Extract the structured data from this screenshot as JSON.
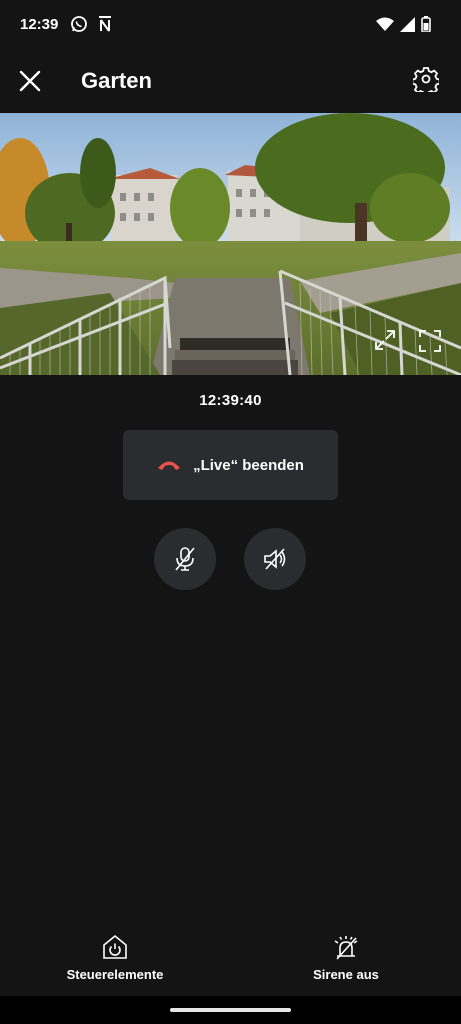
{
  "status_bar": {
    "time": "12:39",
    "left_icons": [
      "whatsapp-icon",
      "notion-icon"
    ],
    "right_icons": [
      "wifi-icon",
      "signal-icon",
      "battery-icon"
    ]
  },
  "header": {
    "title": "Garten",
    "close_icon": "close-icon",
    "settings_icon": "gear-icon"
  },
  "video": {
    "timestamp": "12:39:40"
  },
  "controls": {
    "end_live_label": "„Live“ beenden",
    "end_live_icon": "hang-up-icon",
    "end_live_icon_color": "#e5534b",
    "mic_icon": "mic-off-icon",
    "speaker_icon": "speaker-off-icon"
  },
  "bottom_nav": {
    "controls_label": "Steuerelemente",
    "controls_icon": "home-power-icon",
    "siren_label": "Sirene aus",
    "siren_icon": "siren-off-icon"
  },
  "colors": {
    "background": "#141415",
    "button_bg": "#2b2c2f",
    "text": "#ffffff",
    "accent_red": "#e5534b"
  }
}
